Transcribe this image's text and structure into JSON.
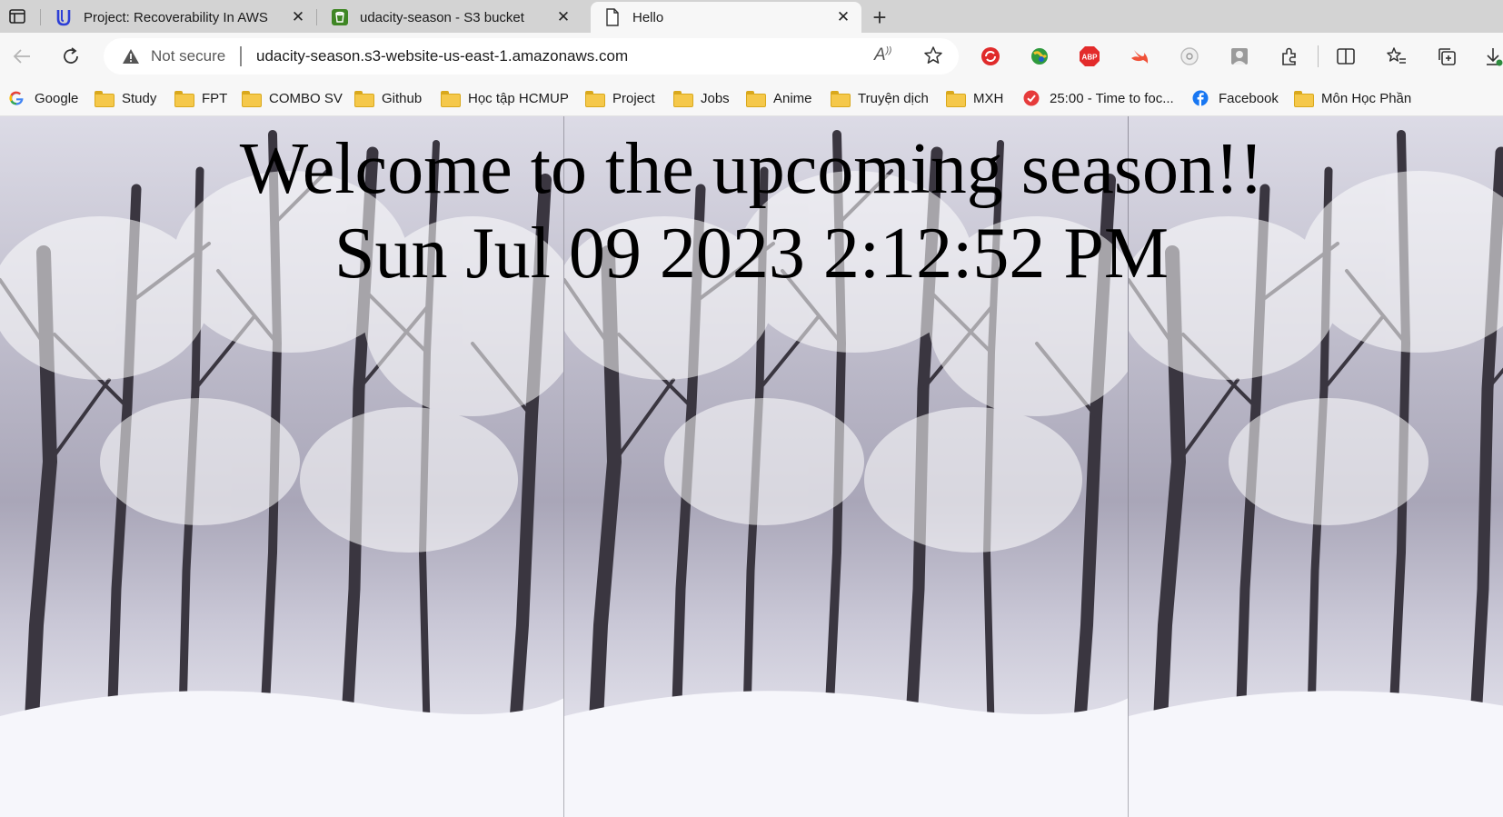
{
  "browser": {
    "tabs": [
      {
        "title": "Project: Recoverability In AWS",
        "icon": "udacity-icon",
        "active": false
      },
      {
        "title": "udacity-season - S3 bucket",
        "icon": "aws-s3-icon",
        "active": false
      },
      {
        "title": "Hello",
        "icon": "page-icon",
        "active": true
      }
    ],
    "address_bar": {
      "security_label": "Not secure",
      "url": "udacity-season.s3-website-us-east-1.amazonaws.com"
    },
    "bookmarks": [
      {
        "label": "Google",
        "icon": "google-icon"
      },
      {
        "label": "Study",
        "icon": "folder-icon"
      },
      {
        "label": "FPT",
        "icon": "folder-icon"
      },
      {
        "label": "COMBO SV",
        "icon": "folder-icon"
      },
      {
        "label": "Github",
        "icon": "folder-icon"
      },
      {
        "label": "Học tập HCMUP",
        "icon": "folder-icon"
      },
      {
        "label": "Project",
        "icon": "folder-icon"
      },
      {
        "label": "Jobs",
        "icon": "folder-icon"
      },
      {
        "label": "Anime",
        "icon": "folder-icon"
      },
      {
        "label": "Truyện dịch",
        "icon": "folder-icon"
      },
      {
        "label": "MXH",
        "icon": "folder-icon"
      },
      {
        "label": "25:00 - Time to foc...",
        "icon": "checkmark-icon"
      },
      {
        "label": "Facebook",
        "icon": "facebook-icon"
      },
      {
        "label": "Môn Học Phần",
        "icon": "folder-icon"
      }
    ],
    "extensions": [
      "sync-icon",
      "globe-icon",
      "adblock-icon",
      "swift-icon",
      "timer-icon",
      "profile-icon",
      "extensions-icon",
      "split-screen-icon",
      "favorites-icon",
      "collections-icon",
      "downloads-icon"
    ]
  },
  "page": {
    "heading": "Welcome to the upcoming season!!",
    "datetime": "Sun Jul 09 2023 2:12:52 PM"
  },
  "colors": {
    "tabstrip": "#d3d3d3",
    "toolbar": "#f7f7f7",
    "folder": "#f5c84a",
    "text": "#000000"
  }
}
